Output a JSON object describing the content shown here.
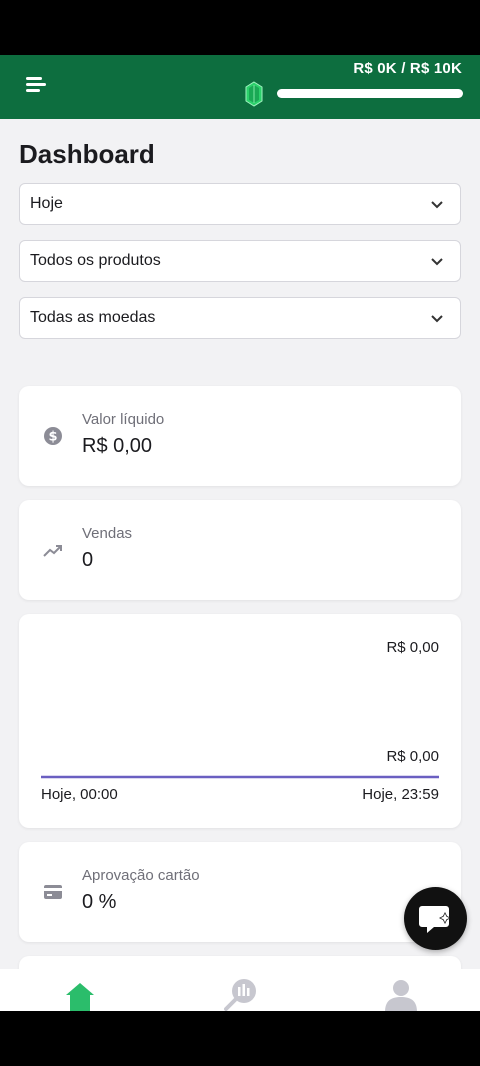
{
  "header": {
    "goal_text": "R$ 0K / R$ 10K",
    "goal_progress": 0,
    "brand_color": "#0d6e3f",
    "icons": [
      "menu-icon",
      "gem-icon"
    ]
  },
  "page": {
    "title": "Dashboard"
  },
  "filters": {
    "period": "Hoje",
    "product": "Todos os produtos",
    "currency": "Todas as moedas"
  },
  "cards": {
    "net_value": {
      "label": "Valor líquido",
      "value": "R$ 0,00",
      "icon": "dollar-coin-icon"
    },
    "sales": {
      "label": "Vendas",
      "value": "0",
      "icon": "trending-up-icon"
    },
    "card_approval": {
      "label": "Aprovação cartão",
      "value": "0 %",
      "icon": "credit-card-icon"
    }
  },
  "chart_data": {
    "type": "line",
    "x": [
      "Hoje, 00:00",
      "Hoje, 23:59"
    ],
    "series": [
      {
        "values": [
          0,
          0
        ],
        "color": "#6a5fc1"
      }
    ],
    "y_top_label": "R$ 0,00",
    "y_bottom_label": "R$ 0,00",
    "x_start_label": "Hoje, 00:00",
    "x_end_label": "Hoje, 23:59"
  },
  "bottom_nav": {
    "items": [
      "home-icon",
      "analytics-icon",
      "profile-icon"
    ],
    "active": "home-icon",
    "active_color": "#2bbd6b"
  },
  "fab": {
    "icon": "chat-sparkle-icon"
  }
}
